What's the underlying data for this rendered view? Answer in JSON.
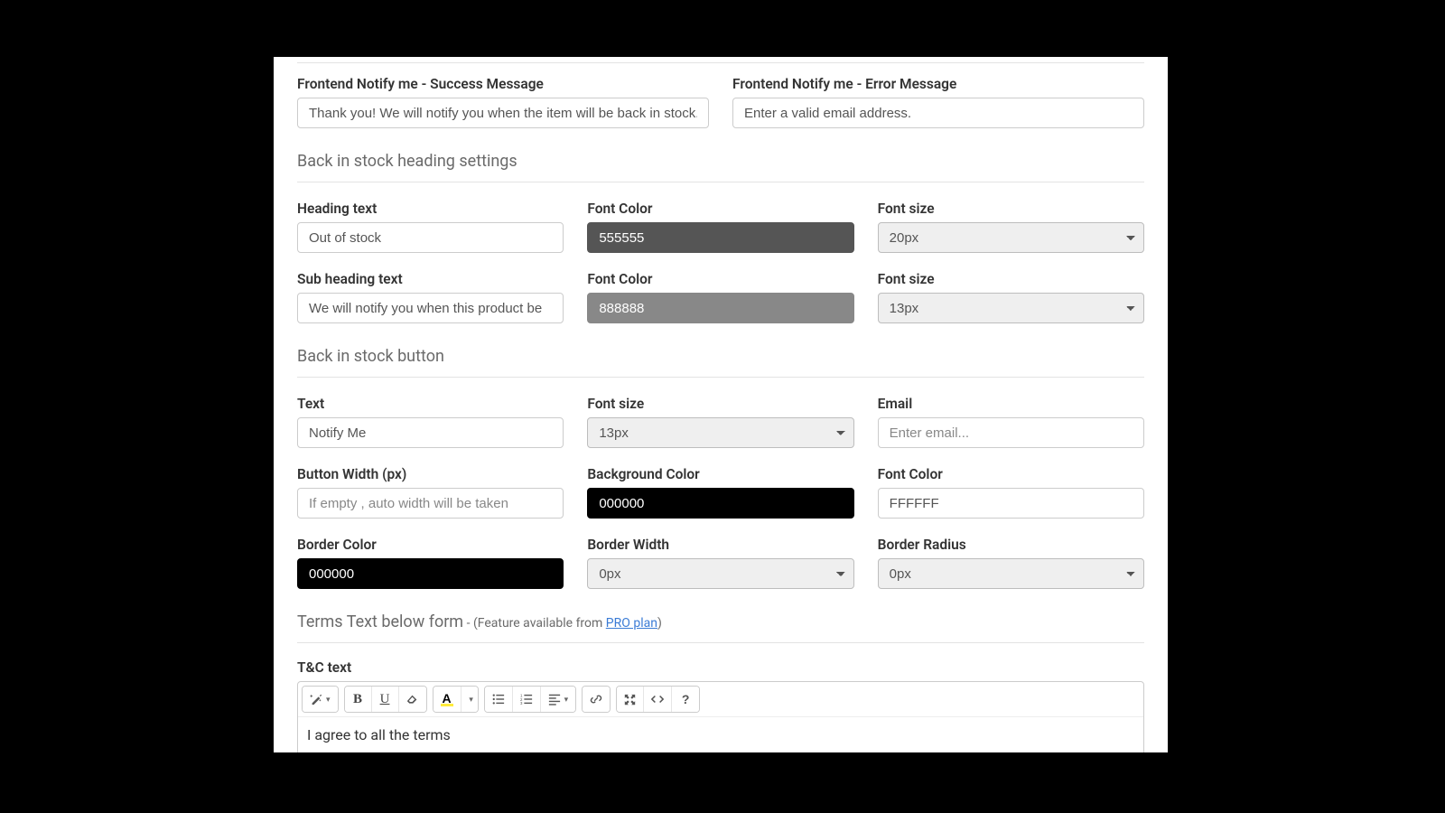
{
  "notify": {
    "success_label": "Frontend Notify me - Success Message",
    "success_value": "Thank you! We will notify you when the item will be back in stock.",
    "error_label": "Frontend Notify me - Error Message",
    "error_value": "Enter a valid email address."
  },
  "heading_section": {
    "title": "Back in stock heading settings",
    "heading_text_label": "Heading text",
    "heading_text_value": "Out of stock",
    "heading_font_color_label": "Font Color",
    "heading_font_color_value": "555555",
    "heading_font_size_label": "Font size",
    "heading_font_size_value": "20px",
    "sub_text_label": "Sub heading text",
    "sub_text_value": "We will notify you when this product be",
    "sub_font_color_label": "Font Color",
    "sub_font_color_value": "888888",
    "sub_font_size_label": "Font size",
    "sub_font_size_value": "13px"
  },
  "button_section": {
    "title": "Back in stock button",
    "text_label": "Text",
    "text_value": "Notify Me",
    "font_size_label": "Font size",
    "font_size_value": "13px",
    "email_label": "Email",
    "email_placeholder": "Enter email...",
    "width_label": "Button Width (px)",
    "width_placeholder": "If empty , auto width will be taken",
    "bg_label": "Background Color",
    "bg_value": "000000",
    "font_color_label": "Font Color",
    "font_color_value": "FFFFFF",
    "border_color_label": "Border Color",
    "border_color_value": "000000",
    "border_width_label": "Border Width",
    "border_width_value": "0px",
    "border_radius_label": "Border Radius",
    "border_radius_value": "0px"
  },
  "terms_section": {
    "title": "Terms Text below form",
    "dash": " - ",
    "note_open": "(",
    "note_text": "Feature available from ",
    "plan_link": "PRO plan",
    "note_close": ")",
    "tc_label": "T&C text",
    "body": "I agree to all the terms"
  }
}
